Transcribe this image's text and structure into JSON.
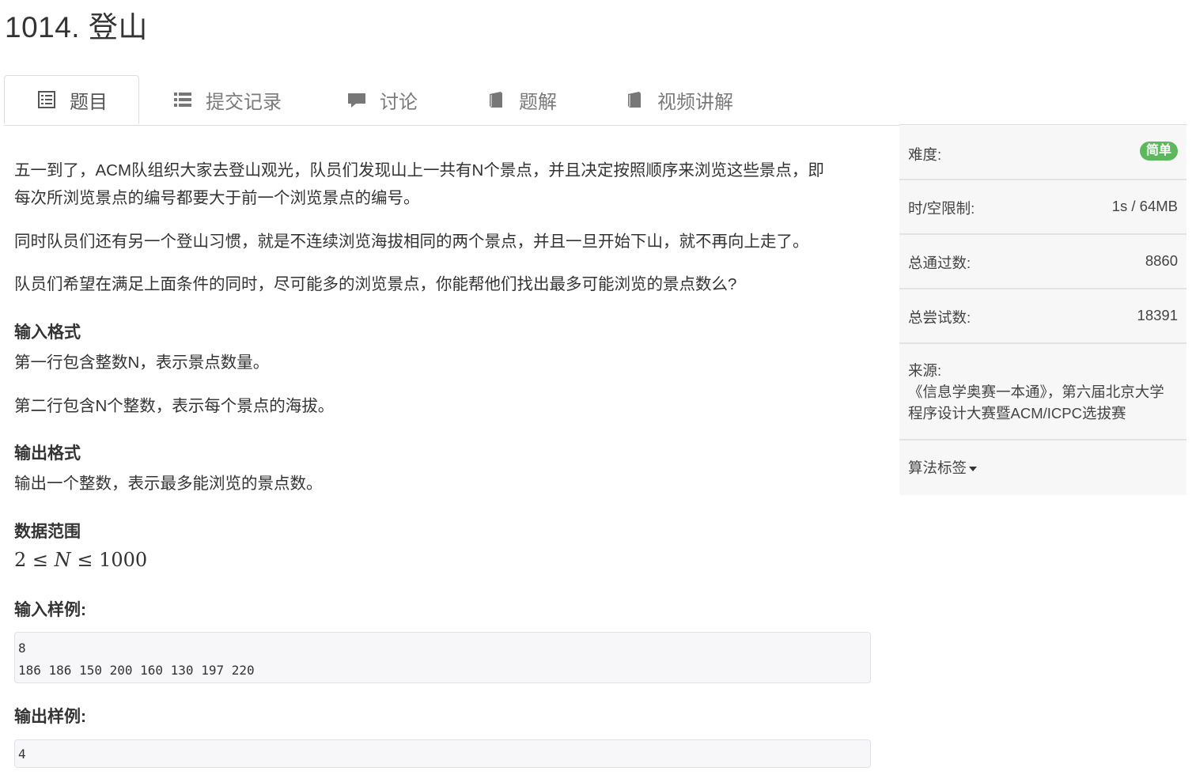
{
  "page": {
    "title": "1014. 登山"
  },
  "tabs": [
    {
      "label": "题目",
      "icon": "list-alt-icon"
    },
    {
      "label": "提交记录",
      "icon": "list-icon"
    },
    {
      "label": "讨论",
      "icon": "comment-icon"
    },
    {
      "label": "题解",
      "icon": "book-icon"
    },
    {
      "label": "视频讲解",
      "icon": "book-icon"
    }
  ],
  "problem": {
    "desc1_line1": "五一到了，ACM队组织大家去登山观光，队员们发现山上一共有N个景点，并且决定按照顺序来浏览这些景点，即",
    "desc1_line2": "每次所浏览景点的编号都要大于前一个浏览景点的编号。",
    "desc2": "同时队员们还有另一个登山习惯，就是不连续浏览海拔相同的两个景点，并且一旦开始下山，就不再向上走了。",
    "desc3": "队员们希望在满足上面条件的同时，尽可能多的浏览景点，你能帮他们找出最多可能浏览的景点数么?",
    "input_heading": "输入格式",
    "input_line1": "第一行包含整数N，表示景点数量。",
    "input_line2": "第二行包含N个整数，表示每个景点的海拔。",
    "output_heading": "输出格式",
    "output_line1": "输出一个整数，表示最多能浏览的景点数。",
    "range_heading": "数据范围",
    "range": {
      "low": "2",
      "le1": "≤",
      "var": "N",
      "le2": "≤",
      "high": "1000"
    },
    "sample_input_heading": "输入样例:",
    "sample_input_lines": [
      "8",
      "186 186 150 200 160 130 197 220"
    ],
    "sample_output_heading": "输出样例:",
    "sample_output_lines": [
      "4"
    ]
  },
  "sidebar": {
    "difficulty_label": "难度:",
    "difficulty_value": "简单",
    "difficulty_color": "#5cb85c",
    "limit_label": "时/空限制:",
    "limit_value": "1s / 64MB",
    "passed_label": "总通过数:",
    "passed_value": "8860",
    "attempts_label": "总尝试数:",
    "attempts_value": "18391",
    "source_label": "来源:",
    "source_line1": "《信息学奥赛一本通》，第六届北京大学",
    "source_line2": "程序设计大赛暨ACM/ICPC选拔赛",
    "tags_label": "算法标签"
  }
}
